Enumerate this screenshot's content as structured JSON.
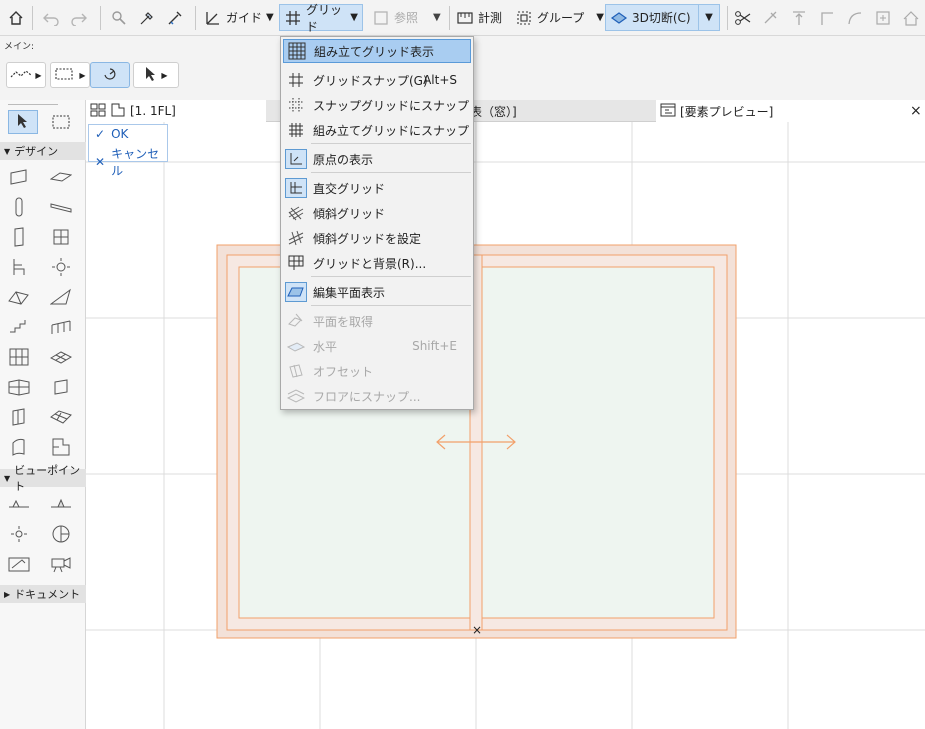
{
  "toolbar": {
    "guide_label": "ガイド",
    "grid_label": "グリッド",
    "reference_label": "参照",
    "measure_label": "計測",
    "group_label": "グループ",
    "cut3d_label": "3D切断(C)"
  },
  "row2": {
    "main_label": "メイン:"
  },
  "toolbox": {
    "design_label": "デザイン",
    "viewpoint_label": "ビューポイント",
    "document_label": "ドキュメント"
  },
  "tabs": {
    "floor_tab": "[1. 1FL]",
    "schedule_tab": "表（窓）]",
    "preview_tab": "[要素プレビュー]",
    "close_glyph": "×"
  },
  "okpanel": {
    "ok_label": "OK",
    "cancel_label": "キャンセル"
  },
  "menu": {
    "items": [
      {
        "label": "組み立てグリッド表示",
        "shortcut": "",
        "state": "highlighted",
        "icon": "construction-grid-icon"
      },
      {
        "label": "グリッドスナップ(G)",
        "shortcut": "Alt+S",
        "state": "normal",
        "icon": "grid-snap-icon"
      },
      {
        "label": "スナップグリッドにスナップ",
        "shortcut": "",
        "state": "normal",
        "icon": "snap-grid-icon"
      },
      {
        "label": "組み立てグリッドにスナップ",
        "shortcut": "",
        "state": "normal",
        "icon": "construction-snap-icon"
      },
      {
        "label": "原点の表示",
        "shortcut": "",
        "state": "checked",
        "icon": "origin-icon"
      },
      {
        "label": "直交グリッド",
        "shortcut": "",
        "state": "checked",
        "icon": "orthogonal-grid-icon"
      },
      {
        "label": "傾斜グリッド",
        "shortcut": "",
        "state": "normal",
        "icon": "skewed-grid-icon"
      },
      {
        "label": "傾斜グリッドを設定",
        "shortcut": "",
        "state": "normal",
        "icon": "set-skewed-grid-icon"
      },
      {
        "label": "グリッドと背景(R)...",
        "shortcut": "",
        "state": "normal",
        "icon": "grid-background-icon"
      },
      {
        "label": "編集平面表示",
        "shortcut": "",
        "state": "checked",
        "icon": "edit-plane-icon"
      },
      {
        "label": "平面を取得",
        "shortcut": "",
        "state": "disabled",
        "icon": "get-plane-icon"
      },
      {
        "label": "水平",
        "shortcut": "Shift+E",
        "state": "disabled",
        "icon": "horizontal-icon"
      },
      {
        "label": "オフセット",
        "shortcut": "",
        "state": "disabled",
        "icon": "offset-icon"
      },
      {
        "label": "フロアにスナップ...",
        "shortcut": "",
        "state": "disabled",
        "icon": "snap-floor-icon"
      }
    ]
  },
  "colors": {
    "accent": "#5a9ad8",
    "window_frame": "#f2a06a",
    "frame_fill": "#f3e1d8",
    "glass_fill": "#eef5f0"
  },
  "canvas": {
    "marker_glyph": "×"
  }
}
